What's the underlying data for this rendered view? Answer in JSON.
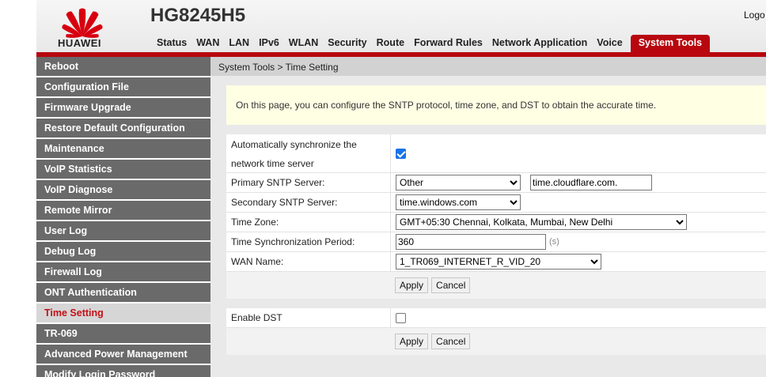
{
  "header": {
    "brand": "HUAWEI",
    "model": "HG8245H5",
    "logout": "Logo",
    "nav": [
      "Status",
      "WAN",
      "LAN",
      "IPv6",
      "WLAN",
      "Security",
      "Route",
      "Forward Rules",
      "Network Application",
      "Voice"
    ],
    "nav_active": "System Tools",
    "accent_color": "#b8070f"
  },
  "sidebar": {
    "items": [
      "Reboot",
      "Configuration File",
      "Firmware Upgrade",
      "Restore Default Configuration",
      "Maintenance",
      "VoIP Statistics",
      "VoIP Diagnose",
      "Remote Mirror",
      "User Log",
      "Debug Log",
      "Firewall Log",
      "ONT Authentication",
      "Time Setting",
      "TR-069",
      "Advanced Power Management",
      "Modify Login Password"
    ],
    "active": "Time Setting"
  },
  "breadcrumb": "System Tools > Time Setting",
  "info": "On this page, you can configure the SNTP protocol, time zone, and DST to obtain the accurate time.",
  "form": {
    "auto_sync_label": "Automatically synchronize the network time server",
    "auto_sync_checked": true,
    "primary_label": "Primary SNTP Server:",
    "primary_select": "Other",
    "primary_custom": "time.cloudflare.com.",
    "secondary_label": "Secondary SNTP Server:",
    "secondary_select": "time.windows.com",
    "timezone_label": "Time Zone:",
    "timezone_select": "GMT+05:30 Chennai, Kolkata, Mumbai, New Delhi",
    "period_label": "Time Synchronization Period:",
    "period_value": "360",
    "period_unit": "(s)",
    "wan_label": "WAN Name:",
    "wan_select": "1_TR069_INTERNET_R_VID_20",
    "apply": "Apply",
    "cancel": "Cancel"
  },
  "dst": {
    "label": "Enable DST",
    "checked": false,
    "apply": "Apply",
    "cancel": "Cancel"
  }
}
